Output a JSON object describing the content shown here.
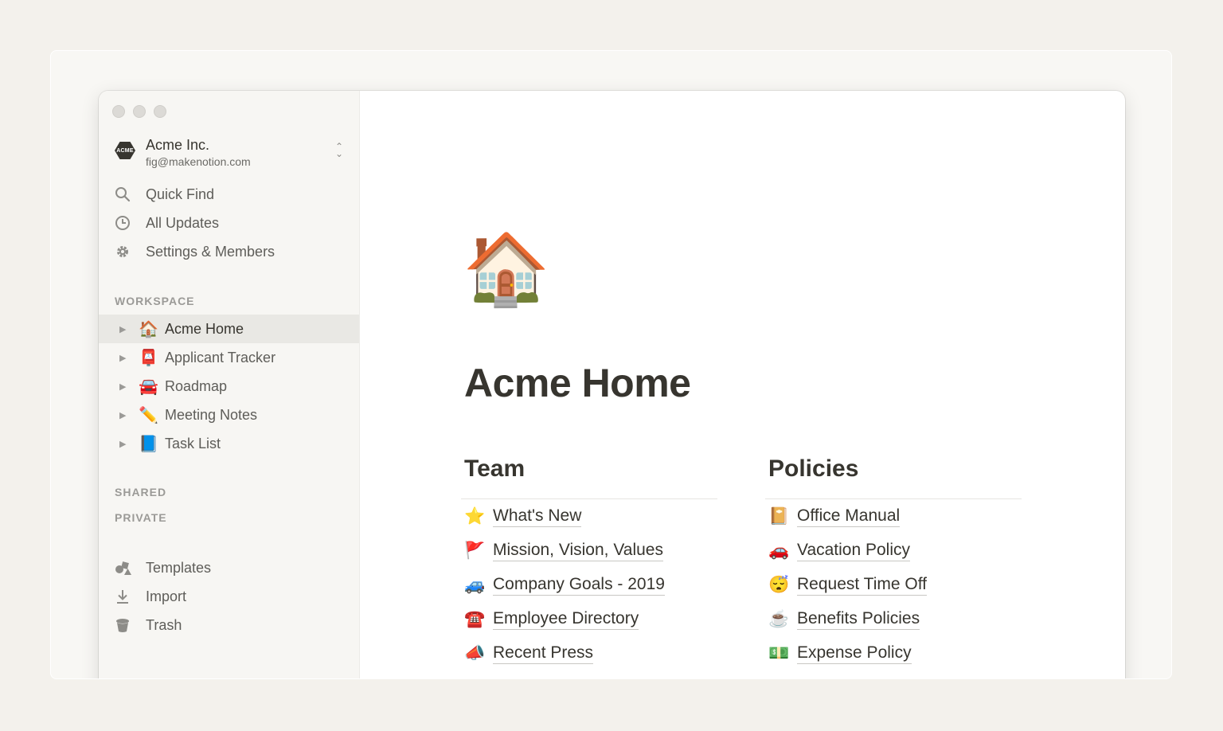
{
  "workspace": {
    "logo_text": "ACME",
    "name": "Acme Inc.",
    "email": "fig@makenotion.com"
  },
  "nav": [
    {
      "label": "Quick Find",
      "icon": "search-icon"
    },
    {
      "label": "All Updates",
      "icon": "clock-icon"
    },
    {
      "label": "Settings & Members",
      "icon": "gear-icon"
    }
  ],
  "sections": {
    "workspace": "WORKSPACE",
    "shared": "SHARED",
    "private": "PRIVATE"
  },
  "pages": [
    {
      "emoji": "🏠",
      "label": "Acme Home",
      "active": true
    },
    {
      "emoji": "📮",
      "label": "Applicant Tracker",
      "active": false
    },
    {
      "emoji": "🚘",
      "label": "Roadmap",
      "active": false
    },
    {
      "emoji": "✏️",
      "label": "Meeting Notes",
      "active": false
    },
    {
      "emoji": "📘",
      "label": "Task List",
      "active": false
    }
  ],
  "bottom_nav": [
    {
      "label": "Templates",
      "icon": "templates-icon"
    },
    {
      "label": "Import",
      "icon": "download-icon"
    },
    {
      "label": "Trash",
      "icon": "trash-icon"
    }
  ],
  "main": {
    "icon": "🏠",
    "title": "Acme Home",
    "team": {
      "heading": "Team",
      "links": [
        {
          "emoji": "⭐",
          "label": "What's New"
        },
        {
          "emoji": "🚩",
          "label": "Mission, Vision, Values"
        },
        {
          "emoji": "🚙",
          "label": "Company Goals - 2019"
        },
        {
          "emoji": "☎️",
          "label": "Employee Directory"
        },
        {
          "emoji": "📣",
          "label": "Recent Press"
        }
      ]
    },
    "policies": {
      "heading": "Policies",
      "links": [
        {
          "emoji": "📔",
          "label": "Office Manual"
        },
        {
          "emoji": "🚗",
          "label": "Vacation Policy"
        },
        {
          "emoji": "😴",
          "label": "Request Time Off"
        },
        {
          "emoji": "☕",
          "label": "Benefits Policies"
        },
        {
          "emoji": "💵",
          "label": "Expense Policy"
        }
      ]
    }
  }
}
